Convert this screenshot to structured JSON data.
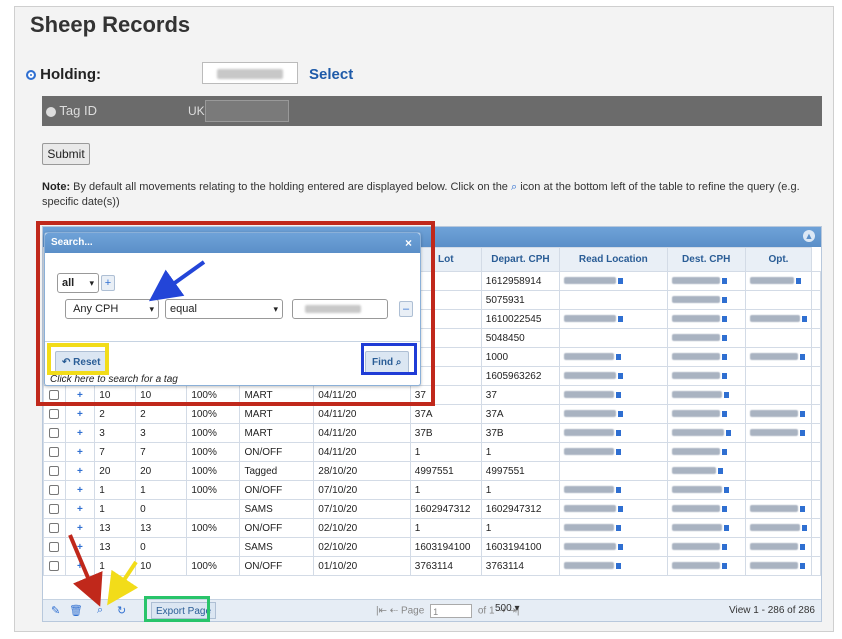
{
  "page": {
    "title": "Sheep Records",
    "holding_label": "Holding:",
    "select_label": "Select",
    "tag_label": "Tag ID",
    "uk_prefix": "UK",
    "submit_label": "Submit",
    "note_bold": "Note:",
    "note_text_1": " By default all movements relating to the holding entered are displayed below. Click on the ",
    "note_text_2": " icon at the bottom left of the table to refine the query (e.g. specific date(s))"
  },
  "grid": {
    "columns_visible": [
      "Lot",
      "Depart. CPH",
      "Read Location",
      "Dest. CPH",
      "Opt."
    ],
    "rows": [
      [
        "",
        "",
        "",
        "",
        "",
        "",
        "1612958914"
      ],
      [
        "",
        "",
        "",
        "",
        "",
        "",
        "5075931"
      ],
      [
        "",
        "",
        "",
        "",
        "",
        "",
        "1610022545"
      ],
      [
        "",
        "",
        "",
        "",
        "",
        "",
        "5048450"
      ],
      [
        "",
        "",
        "",
        "",
        "",
        "",
        "1000"
      ],
      [
        "",
        "",
        "",
        "",
        "",
        "",
        "1605963262"
      ],
      [
        "10",
        "10",
        "100%",
        "MART",
        "04/11/20",
        "37",
        ""
      ],
      [
        "2",
        "2",
        "100%",
        "MART",
        "04/11/20",
        "37A",
        ""
      ],
      [
        "3",
        "3",
        "100%",
        "MART",
        "04/11/20",
        "37B",
        ""
      ],
      [
        "7",
        "7",
        "100%",
        "ON/OFF",
        "04/11/20",
        "1",
        ""
      ],
      [
        "20",
        "20",
        "100%",
        "Tagged",
        "28/10/20",
        "4997551",
        ""
      ],
      [
        "1",
        "1",
        "100%",
        "ON/OFF",
        "07/10/20",
        "1",
        ""
      ],
      [
        "1",
        "0",
        "",
        "SAMS",
        "07/10/20",
        "1602947312",
        ""
      ],
      [
        "13",
        "13",
        "100%",
        "ON/OFF",
        "02/10/20",
        "1",
        ""
      ],
      [
        "13",
        "0",
        "",
        "SAMS",
        "02/10/20",
        "1603194100",
        ""
      ],
      [
        "1",
        "10",
        "100%",
        "ON/OFF",
        "01/10/20",
        "3763114",
        ""
      ]
    ],
    "pager": {
      "export_label": "Export Page",
      "page_label": "Page",
      "page_value": "1",
      "of_label": "of 1",
      "rows_per_page": "500",
      "view_info": "View 1 - 286 of 286"
    }
  },
  "search_dialog": {
    "title": "Search...",
    "close_glyph": "×",
    "group_op": "all",
    "field": "Any CPH",
    "operator": "equal",
    "reset_label": "Reset",
    "find_label": "Find",
    "hint": "Click here to search for a tag"
  },
  "colors": {
    "header_blue": "#5b8fc8",
    "link_blue": "#1e5aa8",
    "highlight_red": "#c0281b",
    "highlight_yellow": "#f2dc19",
    "highlight_blue": "#1f3cd6",
    "highlight_green": "#29c46a"
  }
}
